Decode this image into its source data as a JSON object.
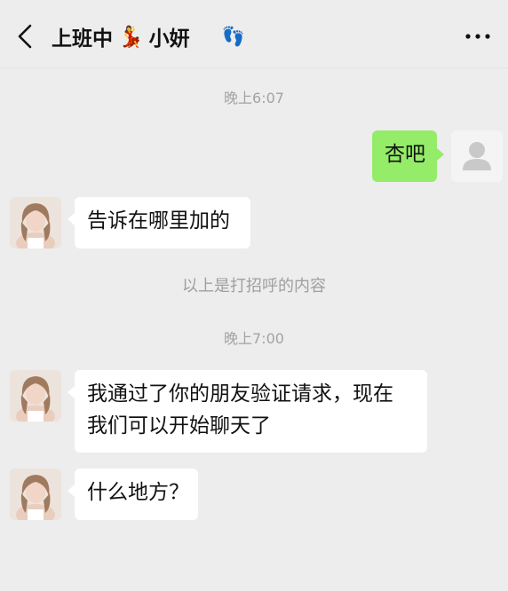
{
  "header": {
    "title_part1": "上班中",
    "title_part2": "小妍",
    "dancer_emoji": "💃",
    "footprints_emoji": "👣",
    "back_icon": "chevron-left-icon",
    "more_icon": "ellipsis-icon"
  },
  "messages": {
    "ts1": "晚上6:07",
    "m1": "杏吧",
    "m2": "告诉在哪里加的",
    "sys1": "以上是打招呼的内容",
    "ts2": "晚上7:00",
    "m3_line1": "我通过了你的朋友验证请求，现在",
    "m3_line2": "我们可以开始聊天了",
    "m4": "什么地方？"
  },
  "colors": {
    "background": "#ededed",
    "outgoing_bubble": "#95ec69",
    "incoming_bubble": "#ffffff"
  }
}
